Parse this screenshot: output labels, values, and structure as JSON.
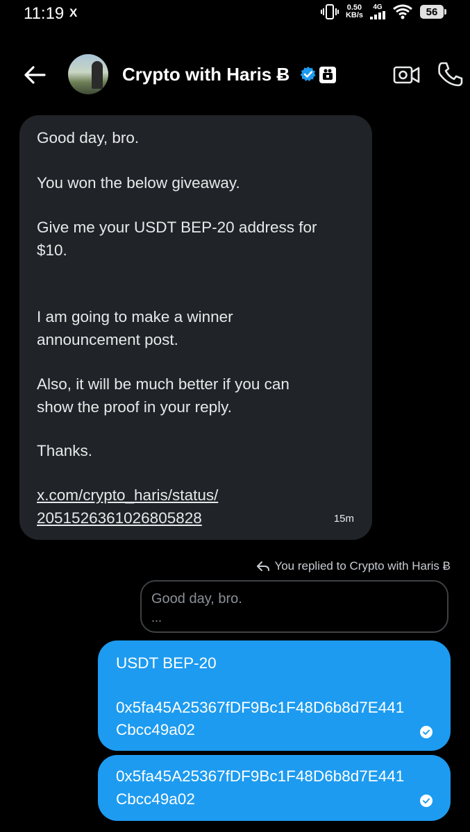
{
  "status_bar": {
    "time": "11:19",
    "notification": "X",
    "net_speed_value": "0.50",
    "net_speed_unit": "KB/s",
    "net_type": "4G",
    "battery": "56"
  },
  "header": {
    "name": "Crypto with Haris Ƀ"
  },
  "incoming_message": {
    "lines": [
      "Good day, bro.",
      "You won the below giveaway.",
      "Give me your USDT BEP-20 address for",
      "$10.",
      "I am going to make a winner",
      "announcement post.",
      "Also, it will be much better if you can",
      "show the proof in your reply.",
      "Thanks.",
      "x.com/crypto_haris/status/",
      "2051526361026805828"
    ],
    "time": "15m"
  },
  "reply_context": {
    "label": "You replied to Crypto with Haris Ƀ",
    "quote_line1": "Good day, bro.",
    "quote_line2": "..."
  },
  "outgoing_messages": [
    {
      "lines": [
        "USDT BEP-20",
        "0x5fa45A25367fDF9Bc1F48D6b8d7E441",
        "Cbcc49a02"
      ]
    },
    {
      "lines": [
        "0x5fa45A25367fDF9Bc1F48D6b8d7E441",
        "Cbcc49a02"
      ]
    }
  ],
  "colors": {
    "background": "#000000",
    "incoming_bubble": "#202327",
    "outgoing_bubble": "#1d9bf0",
    "verified_badge": "#1d9bf0"
  },
  "icons": [
    "back-arrow-icon",
    "verified-badge-icon",
    "affiliate-badge-icon",
    "video-call-icon",
    "phone-call-icon",
    "reply-arrow-icon",
    "read-check-icon"
  ]
}
